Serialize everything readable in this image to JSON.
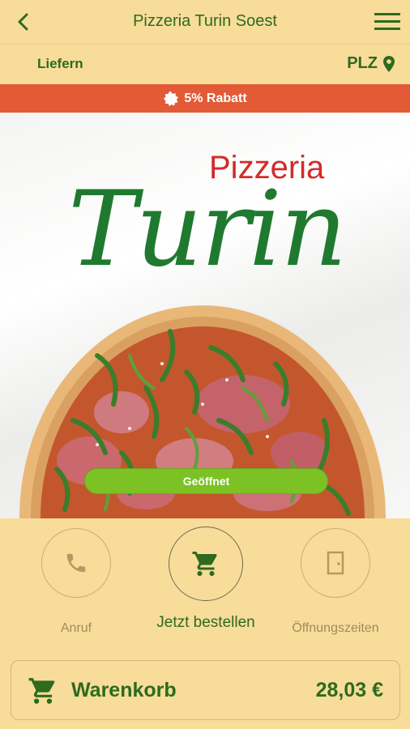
{
  "header": {
    "title": "Pizzeria Turin Soest"
  },
  "subbar": {
    "delivery_mode": "Liefern",
    "plz_label": "PLZ"
  },
  "promo": {
    "text": "5% Rabatt"
  },
  "hero": {
    "logo_small": "Pizzeria",
    "logo_large": "Turin",
    "status_label": "Geöffnet"
  },
  "actions": [
    {
      "label": "Anruf",
      "icon": "phone-icon"
    },
    {
      "label": "Jetzt bestellen",
      "icon": "cart-icon"
    },
    {
      "label": "Öffnungszeiten",
      "icon": "door-icon"
    }
  ],
  "cart": {
    "label": "Warenkorb",
    "total": "28,03 €"
  },
  "colors": {
    "brand_green": "#2d6b1e",
    "background": "#f8dc9a",
    "promo_red": "#e35a36",
    "open_green": "#7cc225"
  }
}
